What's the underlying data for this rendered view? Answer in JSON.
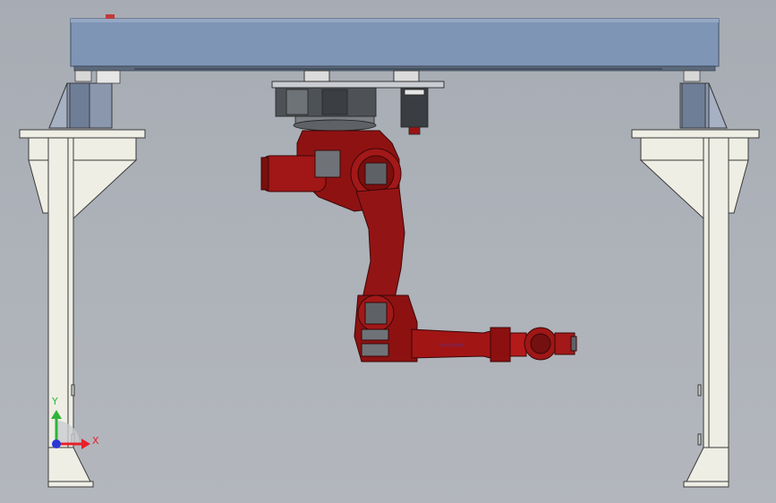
{
  "viewport": {
    "background_top": "#a7acb4",
    "background_bottom": "#b3b7bd"
  },
  "colors": {
    "beam": "#7f95b6",
    "beam_edge": "#4f5f78",
    "support": "#efeee4",
    "support_edge": "#3a3a3a",
    "robot_red": "#9b1414",
    "robot_dark": "#5a0c0c",
    "robot_gray": "#6f7378",
    "bracket": "#8a97ad"
  },
  "triad": {
    "x_label": "X",
    "y_label": "Y",
    "x_color": "#e8202a",
    "y_color": "#2fb43a",
    "z_color": "#2a36d8"
  }
}
